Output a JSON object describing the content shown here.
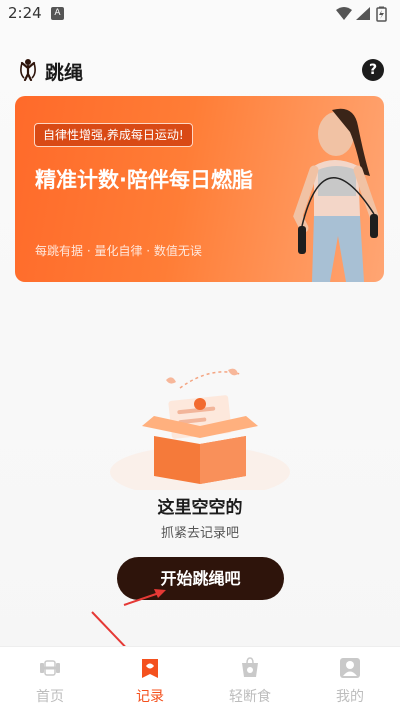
{
  "status_bar": {
    "time": "2:24",
    "notification_badge": "A"
  },
  "header": {
    "title": "跳绳",
    "help_glyph": "?"
  },
  "banner": {
    "tag": "自律性增强,养成每日运动!",
    "title": "精准计数·陪伴每日燃脂",
    "subtitle": "每跳有据 · 量化自律 · 数值无误"
  },
  "empty_state": {
    "title": "这里空空的",
    "subtitle": "抓紧去记录吧"
  },
  "start_button": {
    "label": "开始跳绳吧"
  },
  "nav": {
    "items": [
      {
        "label": "首页",
        "icon": "dumbbell-icon"
      },
      {
        "label": "记录",
        "icon": "record-icon"
      },
      {
        "label": "轻断食",
        "icon": "fasting-icon"
      },
      {
        "label": "我的",
        "icon": "profile-icon"
      }
    ],
    "active_index": 1
  },
  "colors": {
    "accent": "#f4511e",
    "button_bg": "#2e140b",
    "annotation_arrow": "#e53935"
  }
}
